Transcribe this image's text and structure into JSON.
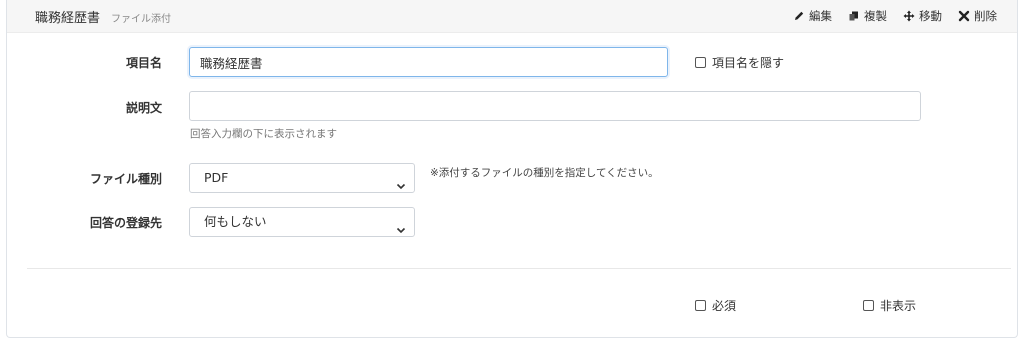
{
  "header": {
    "title": "職務経歴書",
    "subtitle": "ファイル添付",
    "actions": [
      {
        "label": "編集",
        "icon": "pencil-icon"
      },
      {
        "label": "複製",
        "icon": "copy-hand-icon"
      },
      {
        "label": "移動",
        "icon": "move-arrows-icon"
      },
      {
        "label": "削除",
        "icon": "x-icon"
      }
    ]
  },
  "form": {
    "item_name_label": "項目名",
    "item_name_value": "職務経歴書",
    "hide_item_name_label": "項目名を隠す",
    "description_label": "説明文",
    "description_value": "",
    "description_help": "回答入力欄の下に表示されます",
    "file_type_label": "ファイル種別",
    "file_type_value": "PDF",
    "file_type_note": "※添付するファイルの種別を指定してください。",
    "destination_label": "回答の登録先",
    "destination_value": "何もしない"
  },
  "footer": {
    "required_label": "必須",
    "hidden_label": "非表示"
  }
}
